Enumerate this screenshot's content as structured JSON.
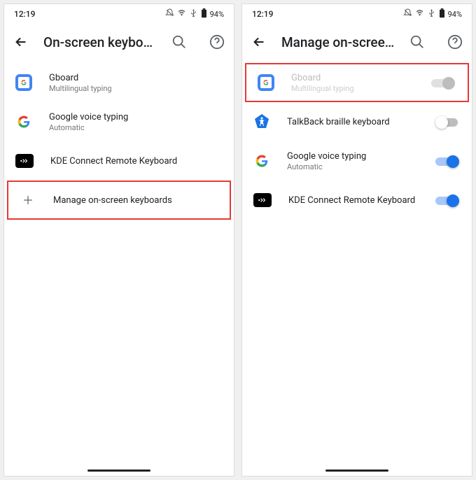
{
  "status_bar": {
    "time": "12:19",
    "battery": "94%"
  },
  "left_screen": {
    "title": "On-screen keyboard",
    "items": [
      {
        "title": "Gboard",
        "sub": "Multilingual typing"
      },
      {
        "title": "Google voice typing",
        "sub": "Automatic"
      },
      {
        "title": "KDE Connect Remote Keyboard"
      },
      {
        "title": "Manage on-screen keyboards"
      }
    ]
  },
  "right_screen": {
    "title": "Manage on-screen ke...",
    "items": [
      {
        "title": "Gboard",
        "sub": "Multilingual typing"
      },
      {
        "title": "TalkBack braille keyboard"
      },
      {
        "title": "Google voice typing",
        "sub": "Automatic"
      },
      {
        "title": "KDE Connect Remote Keyboard"
      }
    ]
  }
}
